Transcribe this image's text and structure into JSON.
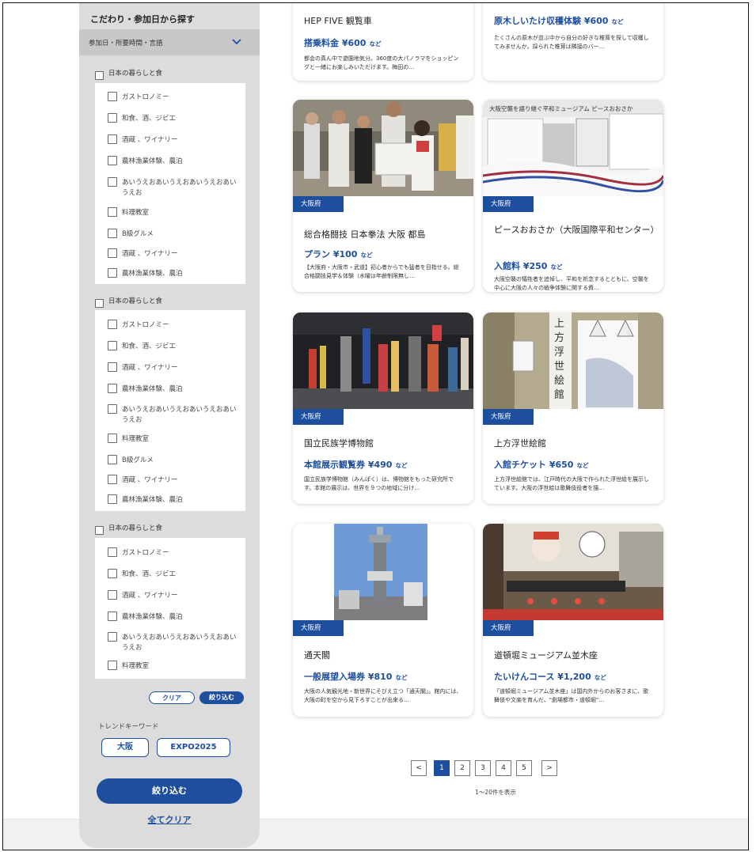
{
  "sidebar": {
    "title": "こだわり・参加日から探す",
    "select_label": "参加日・所要時間・言語",
    "groups": [
      {
        "label": "日本の暮らしと食",
        "items": [
          "ガストロノミー",
          "和食、酒、ジビエ",
          "酒蔵 、ワイナリー",
          "農林漁業体験、農泊",
          "あいうえおあいうえおあいうえおあいうえお",
          "料理教室",
          "B級グルメ",
          "酒蔵 、ワイナリー",
          "農林漁業体験、農泊"
        ]
      },
      {
        "label": "日本の暮らしと食",
        "items": [
          "ガストロノミー",
          "和食、酒、ジビエ",
          "酒蔵 、ワイナリー",
          "農林漁業体験、農泊",
          "あいうえおあいうえおあいうえおあいうえお",
          "料理教室",
          "B級グルメ",
          "酒蔵 、ワイナリー",
          "農林漁業体験、農泊"
        ]
      },
      {
        "label": "日本の暮らしと食",
        "items": [
          "ガストロノミー",
          "和食、酒、ジビエ",
          "酒蔵 、ワイナリー",
          "農林漁業体験、農泊",
          "あいうえおあいうえおあいうえおあいうえお",
          "料理教室"
        ]
      }
    ],
    "clear_label": "クリア",
    "narrow_label": "絞り込む",
    "trend_label": "トレンドキーワード",
    "trends": [
      "大阪",
      "EXPO2025"
    ],
    "submit_label": "絞り込む",
    "clear_all_label": "全てクリア"
  },
  "cards": [
    {
      "title": "HEP FIVE 観覧車",
      "price_label": "搭乗料金",
      "price": "¥600",
      "suffix": "など",
      "desc": "都会の真ん中で遊園地気分。360度の大パノラマをショッピングと一緒にお楽しみいただけます。梅田の…"
    },
    {
      "title": "原木しいたけ収穫体験 ¥600",
      "price_label": "",
      "price": "",
      "suffix": "など",
      "desc": "たくさんの原木が並ぶ中から自分の好きな椎茸を探して収穫してみませんか。採られた椎茸は隣接のバー…"
    },
    {
      "pref": "大阪府",
      "title": "総合格闘技 日本拳法 大阪 都島",
      "price_label": "プラン",
      "price": "¥100",
      "suffix": "など",
      "desc": "【大阪府・大阪市・武道】初心者からでも猛者を目指せる。総合格闘技見学＆体験（水曜は年齢制限無し…"
    },
    {
      "pref": "大阪府",
      "title": "ピースおおさか（大阪国際平和センター）",
      "price_label": "入館料",
      "price": "¥250",
      "suffix": "など",
      "desc": "大阪空襲の犠牲者を追悼し、平和を祈念するとともに、空襲を中心に大阪の人々の戦争体験に関する資…"
    },
    {
      "pref": "大阪府",
      "title": "国立民族学博物館",
      "price_label": "本館展示観覧券",
      "price": "¥490",
      "suffix": "など",
      "desc": "国立民族学博物館（みんぱく）は、博物館をもった研究所です。本館の展示は、世界を９つの地域に分け…"
    },
    {
      "pref": "大阪府",
      "title": "上方浮世絵館",
      "price_label": "入館チケット",
      "price": "¥650",
      "suffix": "など",
      "desc": "上方浮世絵館では、江戸時代の大阪で作られた浮世絵を展示しています。大阪の浮世絵は歌舞伎役者を描…"
    },
    {
      "pref": "大阪府",
      "title": "通天閣",
      "price_label": "一般展望入場券",
      "price": "¥810",
      "suffix": "など",
      "desc": "大阪の人気観光地・新世界にそびえ立つ「通天閣」。館内には、大阪の町を空から見下ろすことが出来る…"
    },
    {
      "pref": "大阪府",
      "title": "道頓堀ミュージアム並木座",
      "price_label": "たいけんコース",
      "price": "¥1,200",
      "suffix": "など",
      "desc": "「道頓堀ミュージアム並木座」は国内外からのお客さまに、歌舞伎や文楽を育んだ、\"劇場都市・道頓堀\"…"
    }
  ],
  "image_signboard": "大阪空襲を語り継ぐ平和ミュージアム ピースおおさか",
  "image_ukiyoe_sign": "上方浮世絵館",
  "pagination": {
    "pages": [
      "1",
      "2",
      "3",
      "4",
      "5"
    ],
    "current": "1",
    "prev": "<",
    "next": ">",
    "info": "1〜20件を表示"
  },
  "colors": {
    "accent": "#1e4e9e",
    "sidebar_bg": "#dcdcdc",
    "select_bg": "#c8c8c8"
  }
}
